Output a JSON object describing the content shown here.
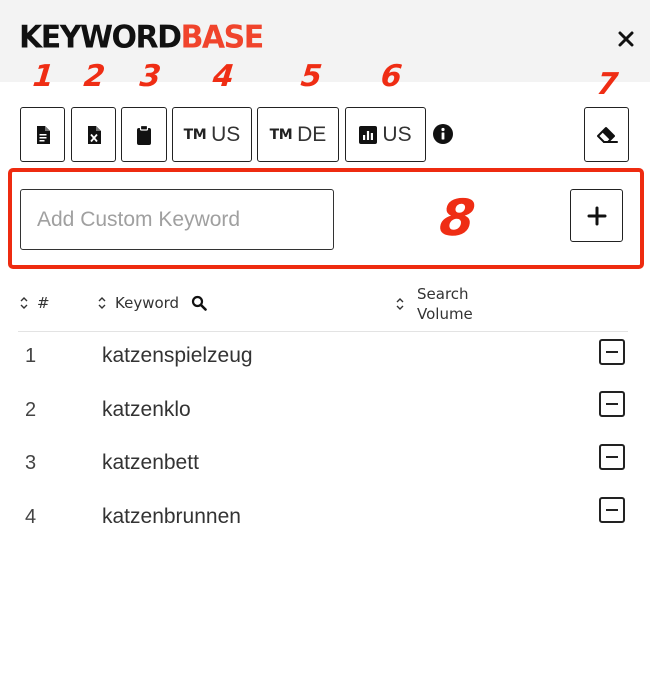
{
  "header": {
    "logo_part1": "KEYWORD",
    "logo_part2": "BASE",
    "close_icon": "close-icon"
  },
  "annotations": [
    "1",
    "2",
    "3",
    "4",
    "5",
    "6",
    "7",
    "8"
  ],
  "toolbar": {
    "buttons": [
      {
        "icon": "document-icon"
      },
      {
        "icon": "excel-file-icon"
      },
      {
        "icon": "clipboard-icon"
      },
      {
        "icon": "trademark-icon",
        "prefix": "TM",
        "label": "US"
      },
      {
        "icon": "trademark-icon",
        "prefix": "TM",
        "label": "DE"
      },
      {
        "icon": "bar-chart-icon",
        "label": "US"
      }
    ],
    "info_icon": "info-icon",
    "eraser_icon": "eraser-icon"
  },
  "add_keyword": {
    "placeholder": "Add Custom Keyword",
    "value": "",
    "add_icon": "plus-icon"
  },
  "table": {
    "columns": {
      "num": "#",
      "keyword": "Keyword",
      "volume_line1": "Search",
      "volume_line2": "Volume"
    },
    "rows": [
      {
        "num": "1",
        "keyword": "katzenspielzeug"
      },
      {
        "num": "2",
        "keyword": "katzenklo"
      },
      {
        "num": "3",
        "keyword": "katzenbett"
      },
      {
        "num": "4",
        "keyword": "katzenbrunnen"
      }
    ]
  },
  "colors": {
    "brand_red": "#f0442c",
    "annotation_red": "#ee2b10",
    "header_bg": "#f3f3f3",
    "text_dark": "#222222"
  }
}
